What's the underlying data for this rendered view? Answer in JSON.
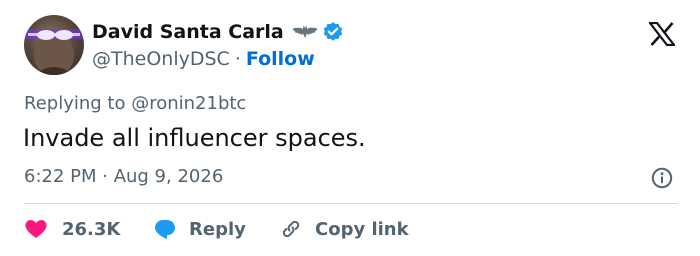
{
  "author": {
    "display_name": "David Santa Carla",
    "handle": "@TheOnlyDSC",
    "follow_label": "Follow",
    "separator": "·",
    "avatar_icon": "avatar-photo",
    "badge_icon": "bat-emoji",
    "verified_icon": "verified-check-icon"
  },
  "reply_context": "Replying to @ronin21btc",
  "tweet_text": "Invade all influencer spaces.",
  "timestamp": "6:22 PM · Aug 9, 2026",
  "actions": {
    "like_count": "26.3K",
    "reply_label": "Reply",
    "copy_link_label": "Copy link"
  },
  "colors": {
    "like": "#f91880",
    "reply": "#1d9bf0",
    "follow": "#006fd6",
    "verified": "#1d9bf0",
    "secondary_text": "#536471",
    "primary_text": "#0f1419"
  }
}
